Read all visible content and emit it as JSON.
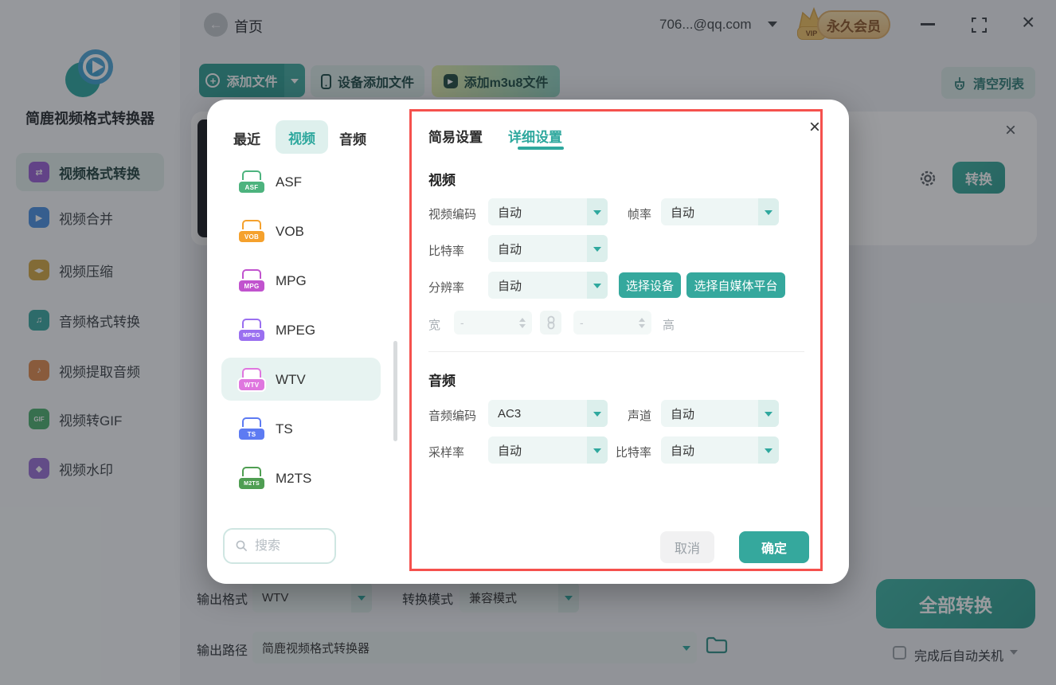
{
  "app_title": "简鹿视频格式转换器",
  "topbar": {
    "home": "首页",
    "account": "706...@qq.com",
    "vip": "永久会员",
    "vip_tag": "VIP"
  },
  "sidebar": [
    {
      "label": "视频格式转换",
      "color": "#9a5fd6",
      "glyph": "⇄"
    },
    {
      "label": "视频合并",
      "color": "#4a90e2",
      "glyph": "▶"
    },
    {
      "label": "视频压缩",
      "color": "#d4a843",
      "glyph": "◀▶"
    },
    {
      "label": "音频格式转换",
      "color": "#3aa8a0",
      "glyph": "♫"
    },
    {
      "label": "视频提取音频",
      "color": "#e08a4e",
      "glyph": "♪"
    },
    {
      "label": "视频转GIF",
      "color": "#4caf6e",
      "glyph": "GIF"
    },
    {
      "label": "视频水印",
      "color": "#9a6fd6",
      "glyph": "◆"
    }
  ],
  "toolbar": {
    "add_file": "添加文件",
    "device_add": "设备添加文件",
    "add_m3u8": "添加m3u8文件",
    "clear_list": "清空列表"
  },
  "file_item": {
    "convert": "转换"
  },
  "format_panel": {
    "tabs": [
      {
        "label": "最近"
      },
      {
        "label": "视频"
      },
      {
        "label": "音频"
      }
    ],
    "formats": [
      {
        "name": "ASF",
        "color": "#4db37e"
      },
      {
        "name": "VOB",
        "color": "#f5a12d"
      },
      {
        "name": "MPG",
        "color": "#c153ce"
      },
      {
        "name": "MPEG",
        "color": "#9a6ff0"
      },
      {
        "name": "WTV",
        "color": "#df76df"
      },
      {
        "name": "TS",
        "color": "#5d7bf2"
      },
      {
        "name": "M2TS",
        "color": "#4f9e52"
      }
    ],
    "search_placeholder": "搜索"
  },
  "settings": {
    "tabs": [
      {
        "label": "简易设置"
      },
      {
        "label": "详细设置"
      }
    ],
    "video": {
      "title": "视频",
      "encode_label": "视频编码",
      "encode_value": "自动",
      "fps_label": "帧率",
      "fps_value": "自动",
      "bitrate_label": "比特率",
      "bitrate_value": "自动",
      "resolution_label": "分辨率",
      "resolution_value": "自动",
      "device_btn": "选择设备",
      "platform_btn": "选择自媒体平台",
      "width_label": "宽",
      "width_value": "-",
      "height_label": "高",
      "height_value": "-"
    },
    "audio": {
      "title": "音频",
      "encode_label": "音频编码",
      "encode_value": "AC3",
      "channel_label": "声道",
      "channel_value": "自动",
      "sample_label": "采样率",
      "sample_value": "自动",
      "bitrate_label": "比特率",
      "bitrate_value": "自动"
    },
    "cancel": "取消",
    "ok": "确定"
  },
  "bottom": {
    "format_label": "输出格式",
    "format_value": "WTV",
    "mode_label": "转换模式",
    "mode_value": "兼容模式",
    "path_label": "输出路径",
    "path_value": "简鹿视频格式转换器",
    "convert_all": "全部转换",
    "shutdown": "完成后自动关机"
  },
  "colors": {
    "accent": "#35a89d",
    "highlight_border": "#f5514d"
  }
}
